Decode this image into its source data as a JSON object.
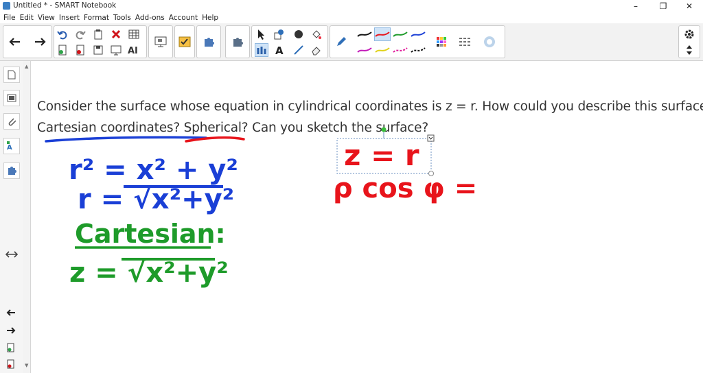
{
  "window": {
    "title": "Untitled * - SMART Notebook",
    "minimize": "–",
    "restore": "❐",
    "close": "✕"
  },
  "menu": [
    "File",
    "Edit",
    "View",
    "Insert",
    "Format",
    "Tools",
    "Add-ons",
    "Account",
    "Help"
  ],
  "question": {
    "line1": "Consider the surface whose equation in cylindrical coordinates is z = r. How could you describe this surface in",
    "line2": "Cartesian coordinates? Spherical? Can you sketch the surface?"
  },
  "handwriting": {
    "eq1": "r² = x² + y²",
    "eq2": "r = √x²+y²",
    "cartesian_label": "Cartesian:",
    "eq3": "z = √x²+y²",
    "boxed_eq": "z = r",
    "spherical_eq": "ρ cos φ ="
  },
  "colors": {
    "blue_ink": "#1a3fd6",
    "green_ink": "#1e9b2a",
    "red_ink": "#e8141b",
    "toolbar_bg": "#f2f2f2",
    "selection": "#cfe3f7"
  }
}
